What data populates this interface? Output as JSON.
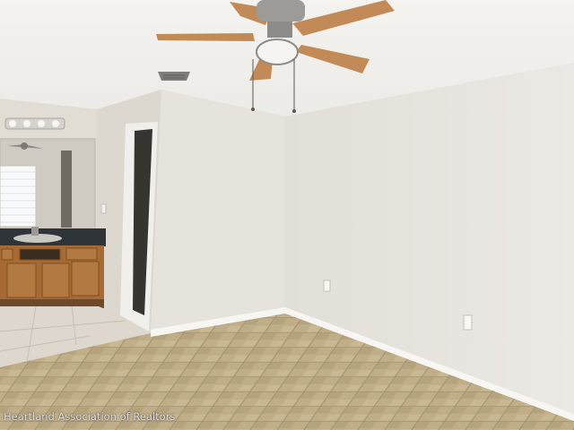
{
  "watermark": {
    "text": "Heartland Association of Realtors"
  },
  "colors": {
    "ceiling": "#f2f1ee",
    "wall_right": "#e8e5df",
    "wall_left": "#dedad3",
    "baseboard": "#f6f5f2",
    "floor_tile": "#bfae88",
    "floor_grout": "#a08f6d",
    "cabinet_wood": "#a66a34",
    "countertop": "#2f3438",
    "fan_blade": "#c18a56",
    "fan_metal": "#8e8c88"
  }
}
